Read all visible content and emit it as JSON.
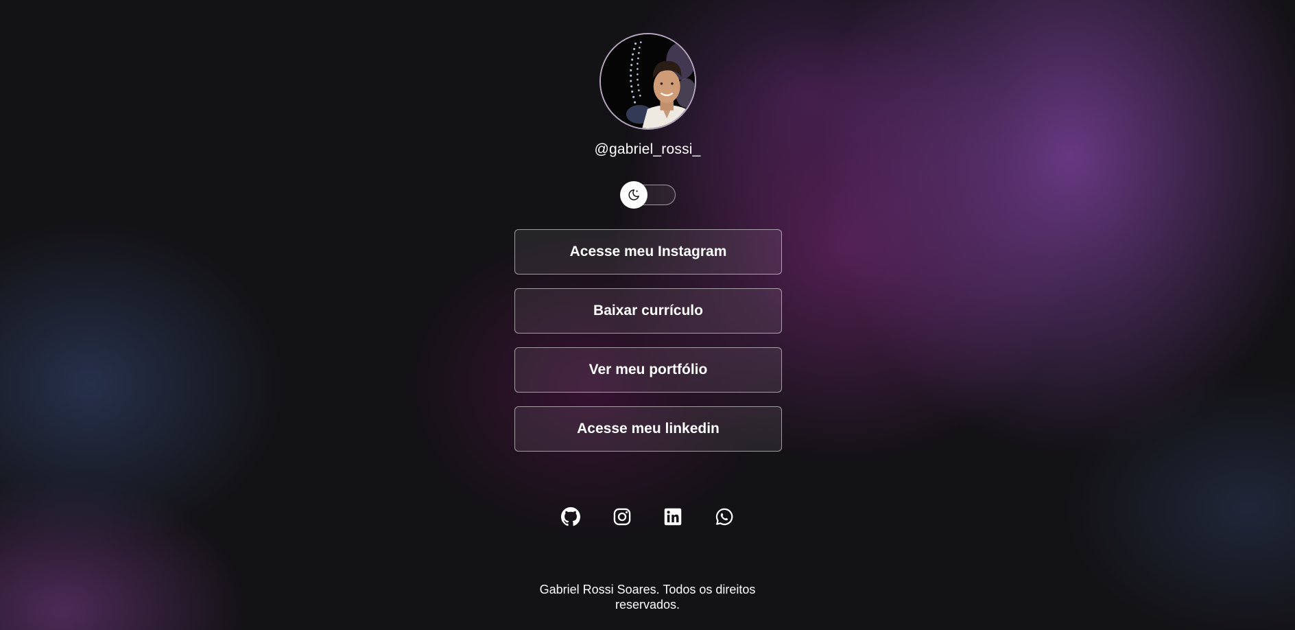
{
  "profile": {
    "handle": "@gabriel_rossi_",
    "avatar_description": "avatar"
  },
  "theme_toggle": {
    "icon": "moon-sparkle-icon",
    "state": "off"
  },
  "links": [
    {
      "label": "Acesse meu Instagram"
    },
    {
      "label": "Baixar currículo"
    },
    {
      "label": "Ver meu portfólio"
    },
    {
      "label": "Acesse meu linkedin"
    }
  ],
  "socials": [
    {
      "icon": "github-icon"
    },
    {
      "icon": "instagram-icon"
    },
    {
      "icon": "linkedin-icon"
    },
    {
      "icon": "whatsapp-icon"
    }
  ],
  "footer": {
    "text": "Gabriel Rossi Soares. Todos os direitos reservados."
  },
  "colors": {
    "text": "#ffffff",
    "background": "#131215",
    "accent_purple": "#763e94",
    "button_border": "#b8b0bc"
  }
}
